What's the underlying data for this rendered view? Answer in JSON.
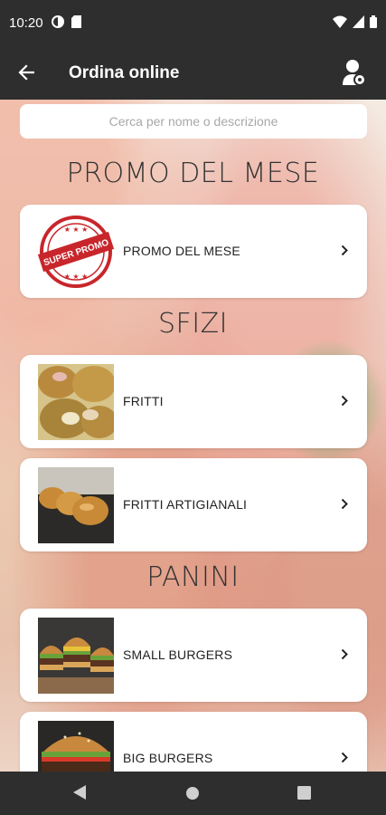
{
  "status_bar": {
    "time": "10:20",
    "icons_left": [
      "data-saver-icon",
      "sim-card-icon"
    ],
    "icons_right": [
      "wifi-icon",
      "cell-signal-icon",
      "battery-icon"
    ]
  },
  "app_bar": {
    "title": "Ordina online",
    "back_icon": "arrow-back-icon",
    "account_icon": "account-settings-icon"
  },
  "search": {
    "placeholder": "Cerca per nome o descrizione",
    "value": ""
  },
  "sections": [
    {
      "title": "PROMO DEL MESE",
      "items": [
        {
          "label": "PROMO DEL MESE",
          "stamp_text": "SUPER PROMO",
          "image": "super-promo-stamp"
        }
      ]
    },
    {
      "title": "SFIZI",
      "items": [
        {
          "label": "FRITTI",
          "image": "fried-snacks-photo"
        },
        {
          "label": "FRITTI ARTIGIANALI",
          "image": "croquettes-photo"
        }
      ]
    },
    {
      "title": "PANINI",
      "items": [
        {
          "label": "SMALL BURGERS",
          "image": "small-burgers-photo"
        },
        {
          "label": "BIG BURGERS",
          "image": "big-burger-photo"
        }
      ]
    }
  ],
  "colors": {
    "app_bar": "#2e2e2e",
    "card": "#ffffff",
    "promo_red": "#c8262b",
    "section_text": "#333333"
  },
  "nav_bar": {
    "buttons": [
      "back-triangle-icon",
      "home-circle-icon",
      "recents-square-icon"
    ]
  }
}
